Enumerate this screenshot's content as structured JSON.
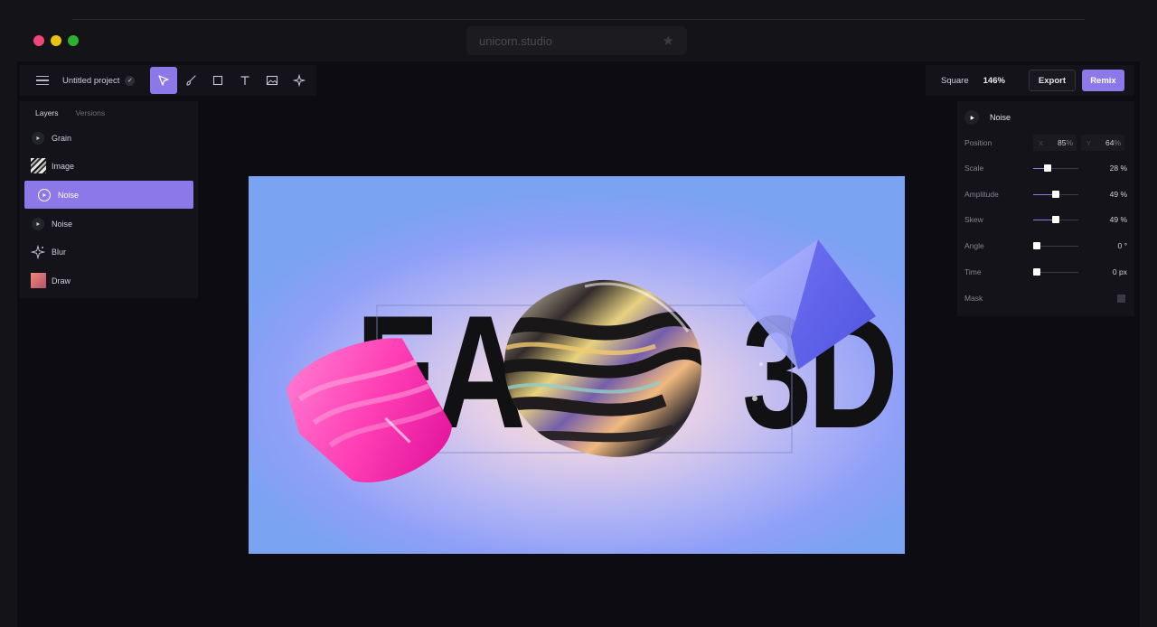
{
  "browser": {
    "url": "unicorn.studio",
    "traffic_colors": [
      "#f0467a",
      "#e8c213",
      "#2cb12e"
    ],
    "bookmark_icon": "star-icon"
  },
  "toolbar": {
    "menu_icon": "hamburger-icon",
    "project_name": "Untitled project",
    "tools": [
      "select-tool",
      "brush-tool",
      "rectangle-tool",
      "text-tool",
      "image-tool",
      "effects-tool"
    ],
    "active_tool": "select-tool",
    "canvas_format": "Square",
    "zoom": "146%",
    "export_label": "Export",
    "remix_label": "Remix"
  },
  "layers_panel": {
    "tabs": [
      {
        "label": "Layers",
        "active": true
      },
      {
        "label": "Versions",
        "active": false
      }
    ],
    "layers": [
      {
        "label": "Grain",
        "icon": "play-icon"
      },
      {
        "label": "Image",
        "icon": "image-thumbnail"
      },
      {
        "label": "Noise",
        "icon": "play-icon",
        "selected": true
      },
      {
        "label": "Noise",
        "icon": "play-icon"
      },
      {
        "label": "Blur",
        "icon": "sparkle-icon"
      },
      {
        "label": "Draw",
        "icon": "draw-thumbnail"
      }
    ]
  },
  "properties": {
    "title": "Noise",
    "position": {
      "label": "Position",
      "x_axis": "X",
      "x": "85",
      "x_unit": "%",
      "y_axis": "Y",
      "y": "64",
      "y_unit": "%"
    },
    "rows": [
      {
        "label": "Scale",
        "value": "28 %",
        "level": 0.28
      },
      {
        "label": "Amplitude",
        "value": "49 %",
        "level": 0.49
      },
      {
        "label": "Skew",
        "value": "49 %",
        "level": 0.49
      },
      {
        "label": "Angle",
        "value": "0 °",
        "level": 0
      },
      {
        "label": "Time",
        "value": "0 px",
        "level": 0
      }
    ],
    "mask_label": "Mask"
  },
  "canvas": {
    "artwork_text_left": "EA",
    "artwork_text_right": "3D",
    "accent_color": "#8c78e8"
  }
}
